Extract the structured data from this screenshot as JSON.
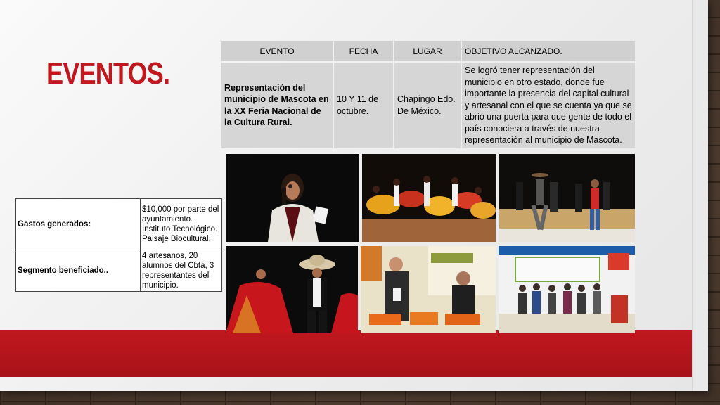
{
  "slide": {
    "title": "EVENTOS."
  },
  "events_table": {
    "headers": [
      "EVENTO",
      "FECHA",
      "LUGAR",
      "OBJETIVO ALCANZADO."
    ],
    "row": {
      "evento": "Representación del municipio de Mascota en la XX  Feria Nacional de la Cultura Rural.",
      "fecha": "10 Y 11 de octubre.",
      "lugar": "Chapingo Edo. De México.",
      "objetivo": "Se logró tener representación del municipio en otro estado, donde fue importante la presencia del capital cultural y artesanal con el que se cuenta  ya que se abrió una puerta para que gente de todo el país conociera a través de nuestra representación al municipio de Mascota."
    }
  },
  "summary_table": {
    "rows": [
      {
        "label": "Gastos generados:",
        "value": " $10,000 por parte del ayuntamiento. Instituto Tecnológico. Paisaje Biocultural."
      },
      {
        "label": "Segmento beneficiado..",
        "value": " 4 artesanos, 20 alumnos del Cbta, 3 representantes del municipio."
      }
    ]
  },
  "colors": {
    "accent_red": "#c0181e",
    "table_cell": "#d6d6d6"
  }
}
